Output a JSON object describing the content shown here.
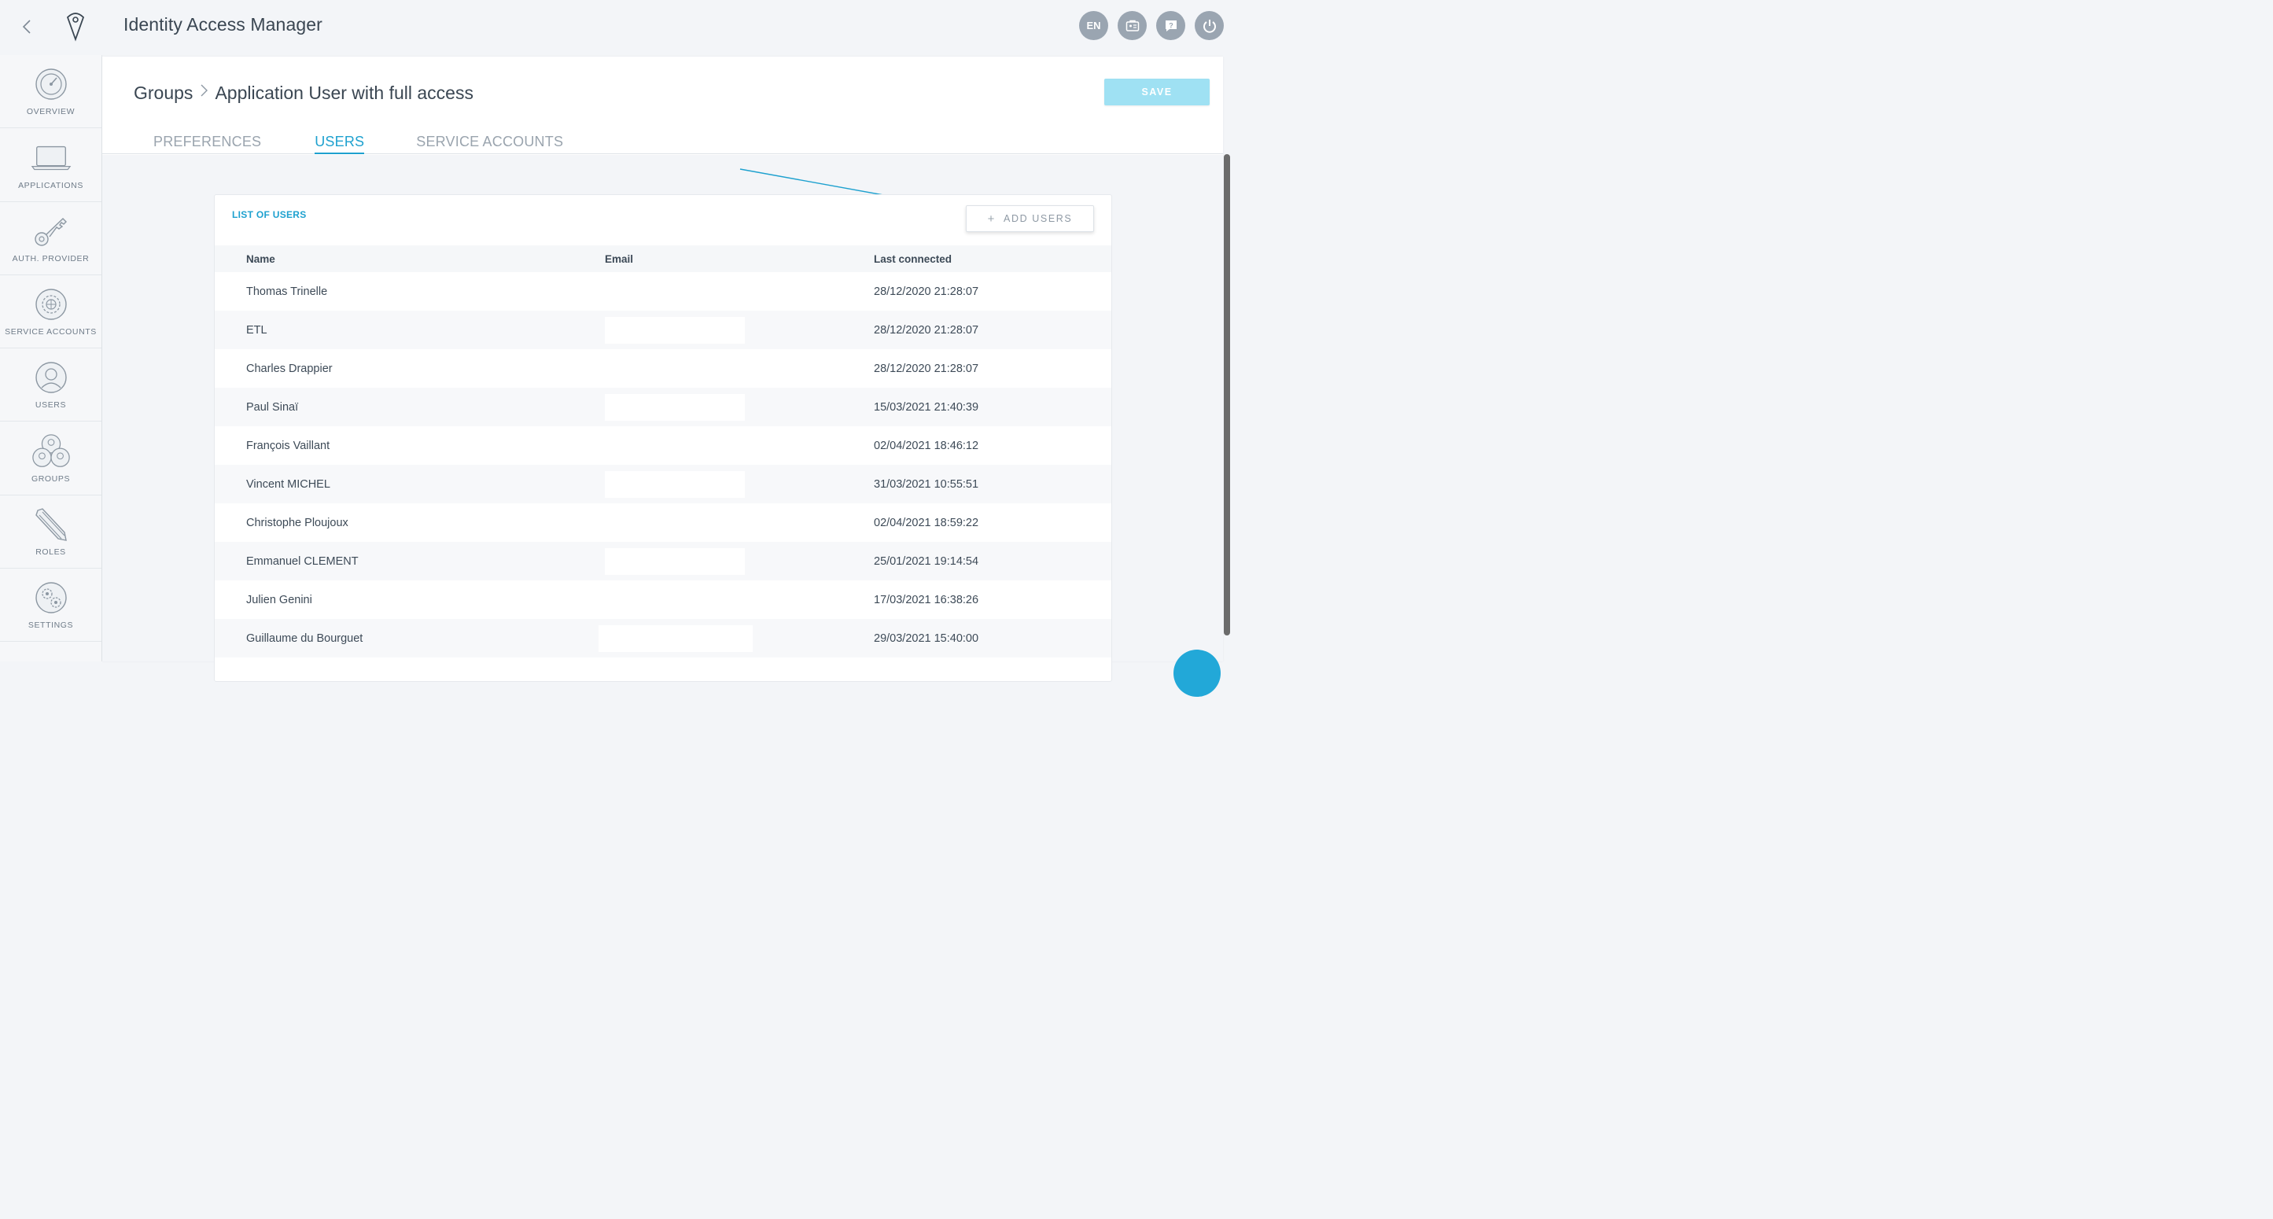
{
  "app": {
    "title": "Identity Access Manager",
    "language": "EN"
  },
  "sidebar": {
    "items": [
      {
        "label": "OVERVIEW",
        "icon": "gauge-icon"
      },
      {
        "label": "APPLICATIONS",
        "icon": "laptop-icon"
      },
      {
        "label": "AUTH. PROVIDER",
        "icon": "key-icon"
      },
      {
        "label": "SERVICE ACCOUNTS",
        "icon": "gear-globe-icon"
      },
      {
        "label": "USERS",
        "icon": "user-icon"
      },
      {
        "label": "GROUPS",
        "icon": "group-icon"
      },
      {
        "label": "ROLES",
        "icon": "pencil-icon"
      },
      {
        "label": "SETTINGS",
        "icon": "gears-icon"
      }
    ]
  },
  "breadcrumb": {
    "parent": "Groups",
    "current": "Application User with full access"
  },
  "toolbar": {
    "save_label": "SAVE"
  },
  "tabs": [
    {
      "label": "PREFERENCES",
      "active": false
    },
    {
      "label": "USERS",
      "active": true
    },
    {
      "label": "SERVICE ACCOUNTS",
      "active": false
    }
  ],
  "users_card": {
    "title": "LIST OF USERS",
    "add_label": "ADD USERS",
    "columns": [
      "Name",
      "Email",
      "Last connected"
    ],
    "rows": [
      {
        "name": "Thomas Trinelle",
        "last": "28/12/2020 21:28:07"
      },
      {
        "name": "ETL",
        "last": "28/12/2020 21:28:07"
      },
      {
        "name": "Charles Drappier",
        "last": "28/12/2020 21:28:07"
      },
      {
        "name": "Paul Sinaï",
        "last": "15/03/2021 21:40:39"
      },
      {
        "name": "François Vaillant",
        "last": "02/04/2021 18:46:12"
      },
      {
        "name": "Vincent MICHEL",
        "last": "31/03/2021 10:55:51"
      },
      {
        "name": "Christophe Ploujoux",
        "last": "02/04/2021 18:59:22"
      },
      {
        "name": "Emmanuel CLEMENT",
        "last": "25/01/2021 19:14:54"
      },
      {
        "name": "Julien Genini",
        "last": "17/03/2021 16:38:26"
      },
      {
        "name": "Guillaume du Bourguet",
        "last": "29/03/2021 15:40:00"
      }
    ]
  },
  "colors": {
    "accent": "#1ea1cf",
    "save_disabled": "#9fe1f3",
    "top_button": "#9aa5b1"
  }
}
